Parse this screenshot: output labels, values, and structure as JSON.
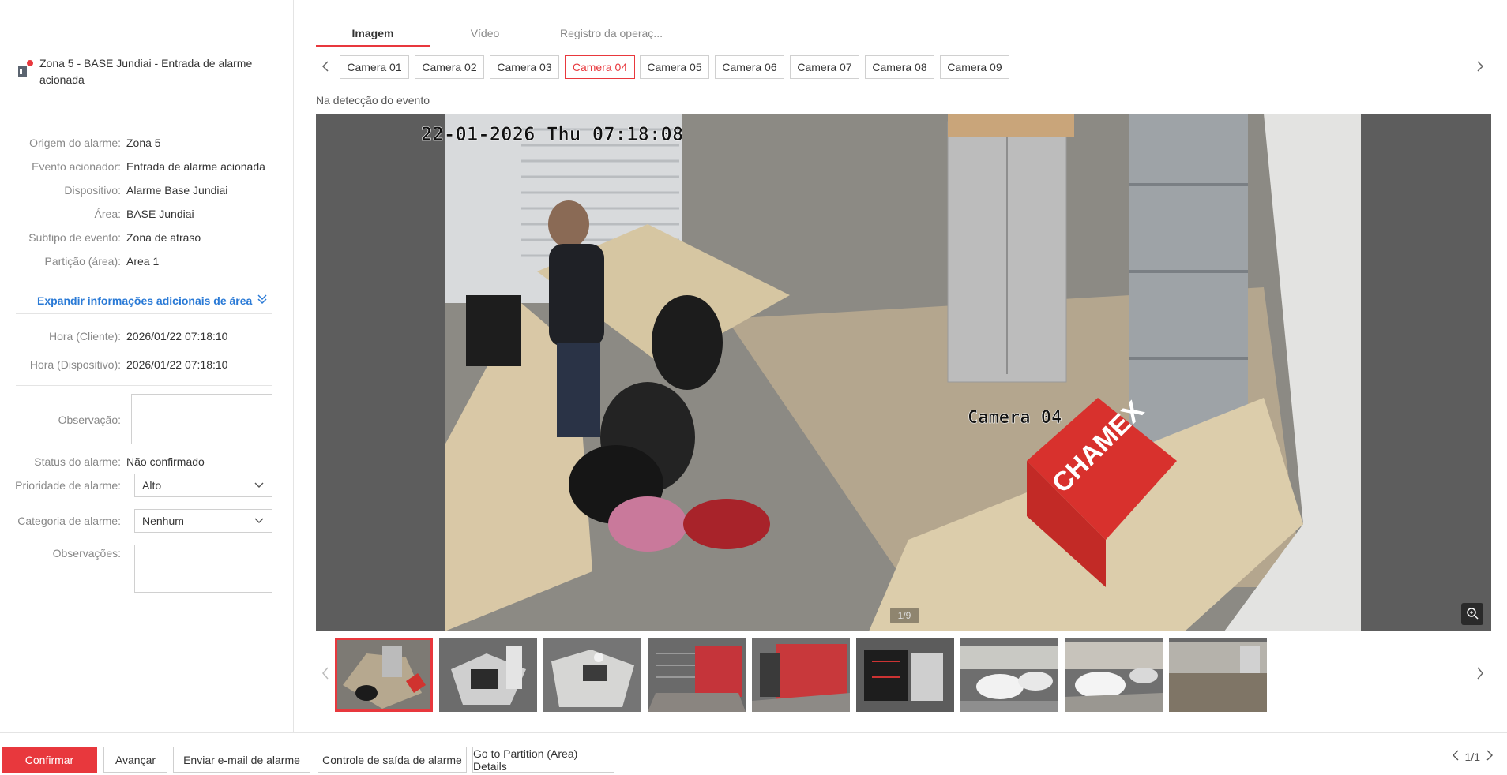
{
  "alarm": {
    "title": "Zona 5 - BASE Jundiai - Entrada de alarme acionada"
  },
  "details": [
    {
      "label": "Origem do alarme:",
      "value": "Zona 5"
    },
    {
      "label": "Evento acionador:",
      "value": "Entrada de alarme acionada"
    },
    {
      "label": "Dispositivo:",
      "value": "Alarme Base Jundiai"
    },
    {
      "label": "Área:",
      "value": "BASE Jundiai"
    },
    {
      "label": "Subtipo de evento:",
      "value": "Zona de atraso"
    },
    {
      "label": "Partição (área):",
      "value": "Area 1"
    }
  ],
  "expand_link": "Expandir informações adicionais de área",
  "times": [
    {
      "label": "Hora (Cliente):",
      "value": "2026/01/22 07:18:10"
    },
    {
      "label": "Hora (Dispositivo):",
      "value": "2026/01/22 07:18:10"
    }
  ],
  "form": {
    "observacao_label": "Observação:",
    "status_label": "Status do alarme:",
    "status_value": "Não confirmado",
    "priority_label": "Prioridade de alarme:",
    "priority_value": "Alto",
    "category_label": "Categoria de alarme:",
    "category_value": "Nenhum",
    "observacoes_label": "Observações:"
  },
  "tabs": [
    {
      "label": "Imagem",
      "active": true
    },
    {
      "label": "Vídeo",
      "active": false
    },
    {
      "label": "Registro da operaç...",
      "active": false
    }
  ],
  "cameras": [
    "Camera 01",
    "Camera 02",
    "Camera 03",
    "Camera 04",
    "Camera 05",
    "Camera 06",
    "Camera 07",
    "Camera 08",
    "Camera 09"
  ],
  "active_camera": "Camera 04",
  "event_note": "Na detecção do evento",
  "image": {
    "timestamp_overlay": "22-01-2026 Thu 07:18:08",
    "camera_overlay": "Camera 04",
    "brand_text": "CHAMEX",
    "page_indicator": "1/9"
  },
  "footer": {
    "confirm": "Confirmar",
    "advance": "Avançar",
    "email": "Enviar e-mail de alarme",
    "output": "Controle de saída de alarme",
    "partition": "Go to Partition (Area) Details",
    "pager": "1/1"
  },
  "colors": {
    "accent": "#e8383d",
    "link": "#2a7ad6"
  }
}
